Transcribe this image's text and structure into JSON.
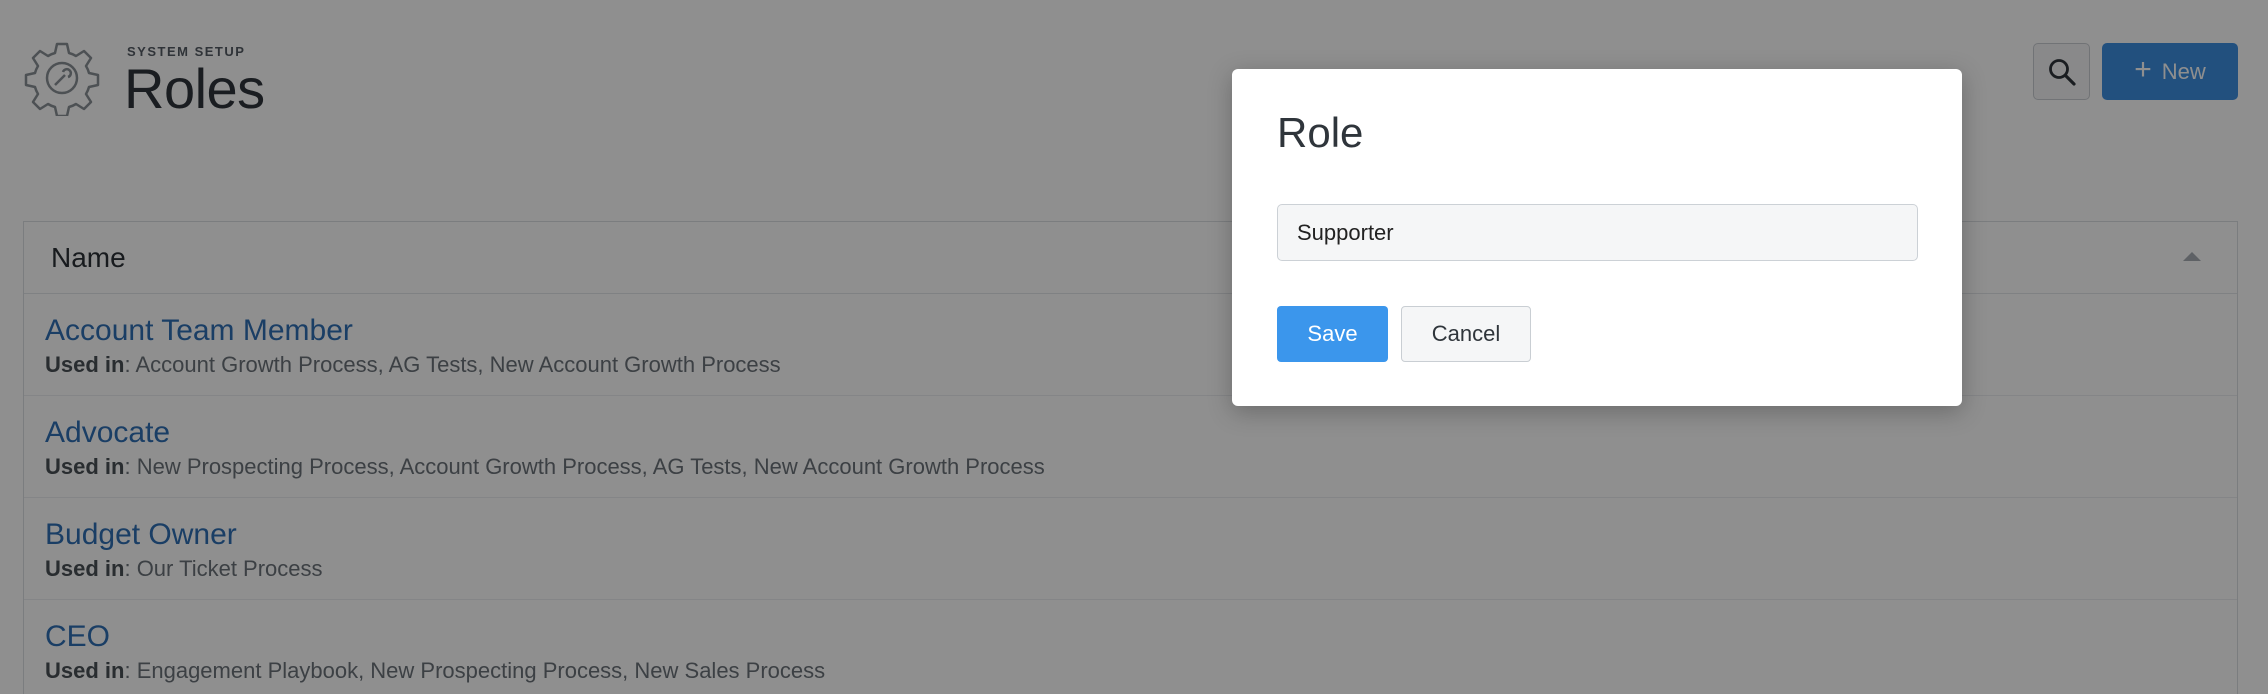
{
  "header": {
    "supertitle": "SYSTEM SETUP",
    "title": "Roles",
    "gear_icon": "gear-wrench-icon",
    "search_icon": "search-icon",
    "new_label": "New",
    "new_icon": "plus-icon",
    "accent_color": "#3e8fe0"
  },
  "table": {
    "column_header": "Name",
    "sort_icon": "sort-ascending-icon",
    "used_in_label": "Used in",
    "rows": [
      {
        "name": "Account Team Member",
        "used_in": ": Account Growth Process, AG Tests, New Account Growth Process"
      },
      {
        "name": "Advocate",
        "used_in": ": New Prospecting Process, Account Growth Process, AG Tests, New Account Growth Process"
      },
      {
        "name": "Budget Owner",
        "used_in": ": Our Ticket Process"
      },
      {
        "name": "CEO",
        "used_in": ": Engagement Playbook, New Prospecting Process, New Sales Process"
      }
    ]
  },
  "modal": {
    "title": "Role",
    "input_value": "Supporter",
    "save_label": "Save",
    "cancel_label": "Cancel",
    "save_color": "#3b96ec"
  }
}
